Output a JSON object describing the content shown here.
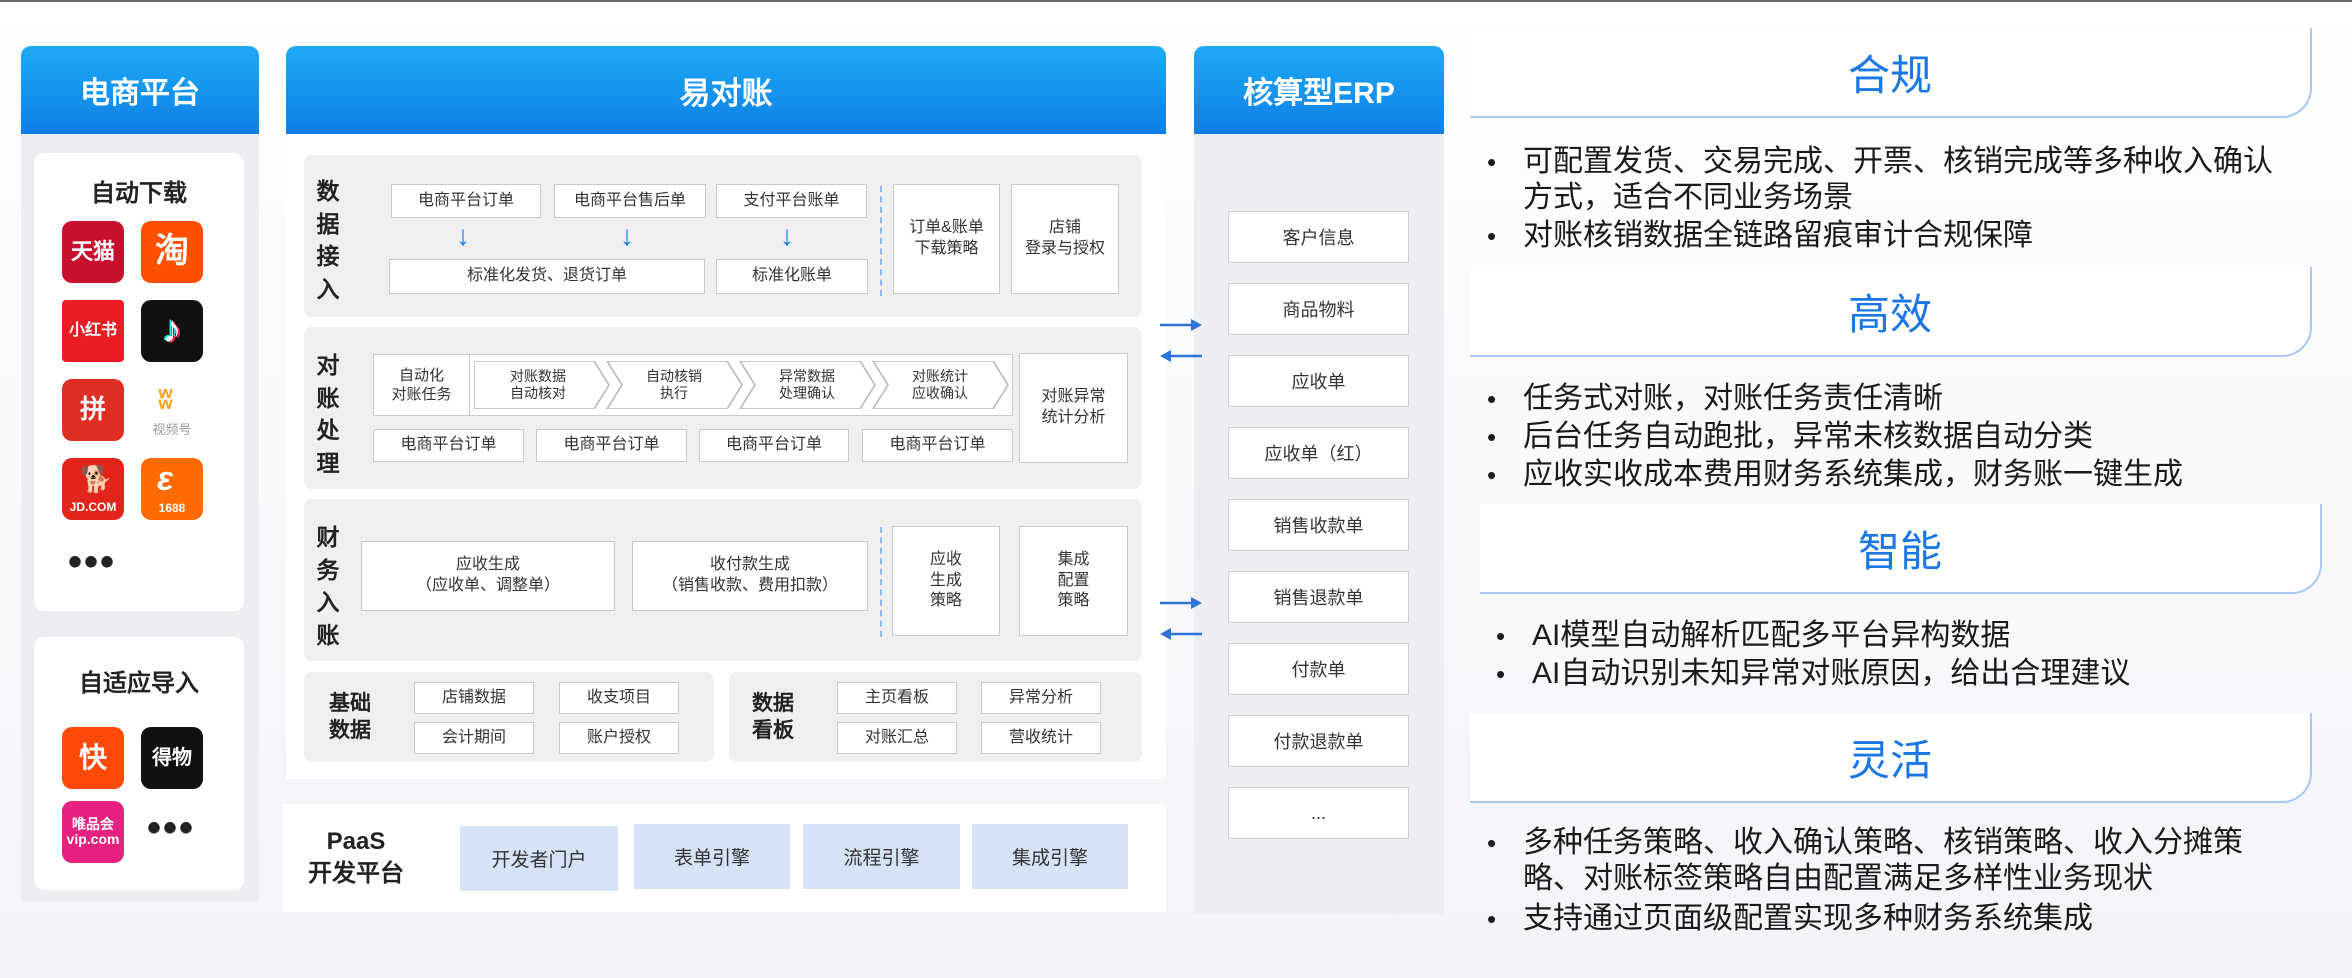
{
  "platform": {
    "title": "电商平台",
    "auto_download": "自动下载",
    "logos": {
      "tmall": "天猫",
      "taobao": "淘",
      "xiaohongshu": "小红书",
      "douyin": "♪",
      "pinduoduo": "拼",
      "wechat_channels": "视频号",
      "jd": "JD.COM",
      "alibaba1688": "1688",
      "kuaishou": "快",
      "dewu": "得物",
      "vip": "唯品会\nvip.com"
    },
    "more1": "•••",
    "adaptive_import": "自适应导入",
    "more2": "•••"
  },
  "center": {
    "title": "易对账",
    "data_access": {
      "label": "数\n据\n接\n入",
      "order": "电商平台订单",
      "aftersale": "电商平台售后单",
      "payment": "支付平台账单",
      "standard_order": "标准化发货、退货订单",
      "standard_bill": "标准化账单",
      "download_strategy": "订单&账单\n下载策略",
      "store_auth": "店铺\n登录与授权"
    },
    "reconcile": {
      "label": "对\n账\n处\n理",
      "auto_task": "自动化\n对账任务",
      "steps": [
        "对账数据\n自动核对",
        "自动核销\n执行",
        "异常数据\n处理确认",
        "对账统计\n应收确认"
      ],
      "orders": [
        "电商平台订单",
        "电商平台订单",
        "电商平台订单",
        "电商平台订单"
      ],
      "anomaly": "对账异常\n统计分析"
    },
    "finance": {
      "label": "财\n务\n入\n账",
      "receivable": "应收生成\n（应收单、调整单）",
      "collection": "收付款生成\n（销售收款、费用扣款）",
      "recv_strategy": "应收\n生成\n策略",
      "integration_strategy": "集成\n配置\n策略"
    },
    "basic": {
      "label": "基础\n数据",
      "items": [
        "店铺数据",
        "收支项目",
        "会计期间",
        "账户授权"
      ]
    },
    "dashboard": {
      "label": "数据\n看板",
      "items": [
        "主页看板",
        "异常分析",
        "对账汇总",
        "营收统计"
      ]
    },
    "paas": {
      "label": "PaaS\n开发平台",
      "items": [
        "开发者门户",
        "表单引擎",
        "流程引擎",
        "集成引擎"
      ]
    }
  },
  "erp": {
    "title": "核算型ERP",
    "items": [
      "客户信息",
      "商品物料",
      "应收单",
      "应收单（红）",
      "销售收款单",
      "销售退款单",
      "付款单",
      "付款退款单",
      "..."
    ]
  },
  "features": [
    {
      "title": "合规",
      "bullets": [
        "可配置发货、交易完成、开票、核销完成等多种收入确认方式，适合不同业务场景",
        "对账核销数据全链路留痕审计合规保障"
      ]
    },
    {
      "title": "高效",
      "bullets": [
        "任务式对账，对账任务责任清晰",
        "后台任务自动跑批，异常未核数据自动分类",
        "应收实收成本费用财务系统集成，财务账一键生成"
      ]
    },
    {
      "title": "智能",
      "bullets": [
        "AI模型自动解析匹配多平台异构数据",
        "AI自动识别未知异常对账原因，给出合理建议"
      ]
    },
    {
      "title": "灵活",
      "bullets": [
        "多种任务策略、收入确认策略、核销策略、收入分摊策略、对账标签策略自由配置满足多样性业务现状",
        "支持通过页面级配置实现多种财务系统集成"
      ]
    }
  ],
  "colors": {
    "accent": "#0c7fe6",
    "feature_title": "#1a77e3",
    "paas_box": "#d5e3f7"
  }
}
